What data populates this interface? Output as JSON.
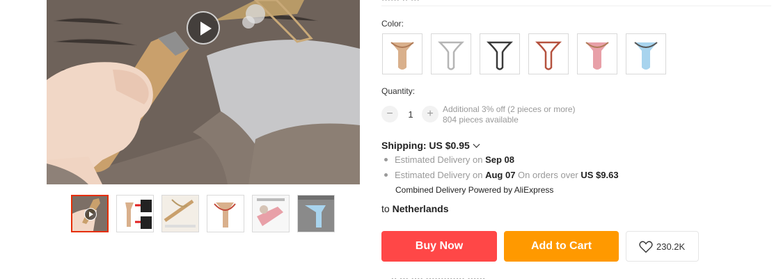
{
  "gallery": {
    "thumbnails": [
      {
        "name": "thumb-video",
        "active": true
      },
      {
        "name": "thumb-2",
        "active": false
      },
      {
        "name": "thumb-3",
        "active": false
      },
      {
        "name": "thumb-4",
        "active": false
      },
      {
        "name": "thumb-5",
        "active": false
      },
      {
        "name": "thumb-6",
        "active": false
      }
    ]
  },
  "options": {
    "top_cut_text": "······ ·· ···",
    "color_label": "Color:",
    "swatch_colors": [
      "#d9b08c",
      "#c9c9c9",
      "#3a3a3a",
      "#b5523f",
      "#e8a0a8",
      "#a8d4ee"
    ],
    "quantity_label": "Quantity:",
    "quantity_value": "1",
    "minus_label": "−",
    "plus_label": "+",
    "discount_note": "Additional 3% off (2 pieces or more)",
    "available_note": "804 pieces available"
  },
  "shipping": {
    "label": "Shipping: US $0.95",
    "delivery": [
      {
        "prefix": "Estimated Delivery on",
        "date": "Sep 08",
        "extra_prefix": "",
        "extra_value": ""
      },
      {
        "prefix": "Estimated Delivery on",
        "date": "Aug 07",
        "extra_prefix": "On orders over",
        "extra_value": "US $9.63"
      }
    ],
    "combined": "Combined Delivery Powered by AliExpress",
    "to_prefix": "to",
    "country": "Netherlands"
  },
  "actions": {
    "buy_now": "Buy Now",
    "add_to_cart": "Add to Cart",
    "wishlist_count": "230.2K"
  },
  "bottom_cut_text": "··  ··· ···· ·············    ······"
}
